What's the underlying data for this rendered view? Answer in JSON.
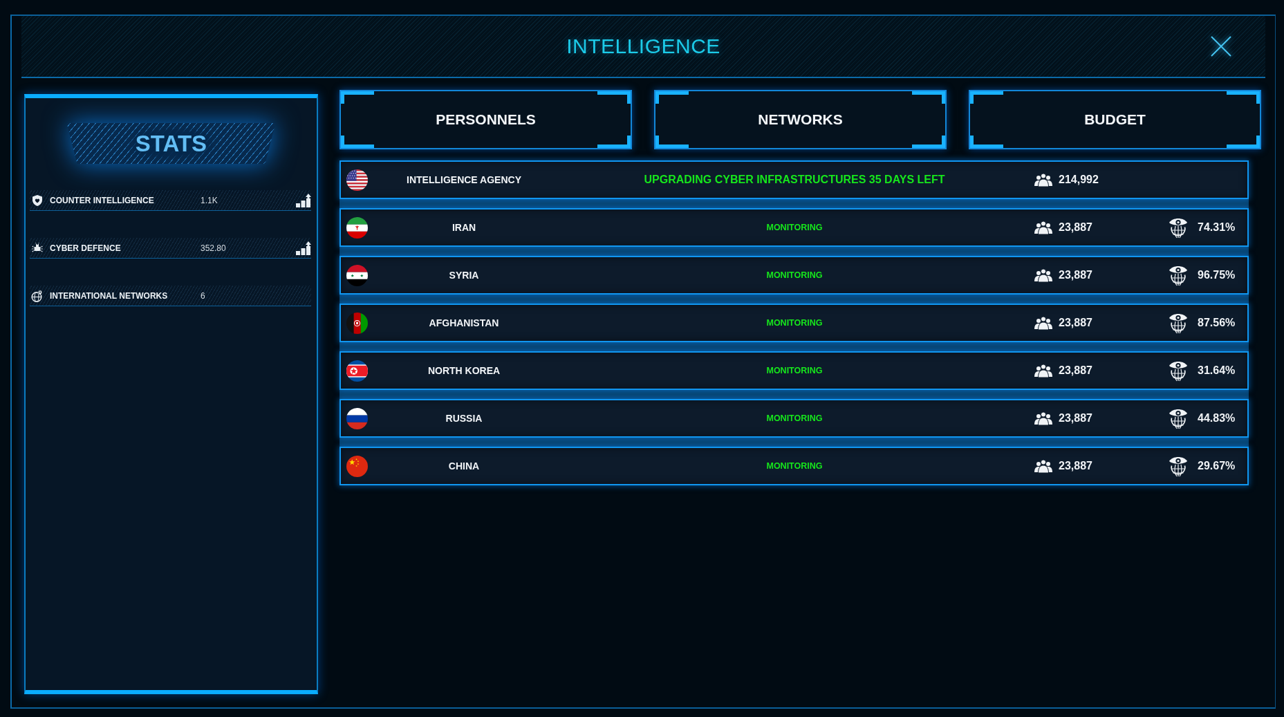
{
  "window": {
    "title": "INTELLIGENCE"
  },
  "stats": {
    "title": "STATS",
    "items": [
      {
        "kind": "counter",
        "label": "COUNTER INTELLIGENCE",
        "value": "1.1K",
        "upgrade": true
      },
      {
        "kind": "defence",
        "label": "CYBER DEFENCE",
        "value": "352.80",
        "upgrade": true
      },
      {
        "kind": "networks",
        "label": "INTERNATIONAL NETWORKS",
        "value": "6",
        "upgrade": false
      }
    ]
  },
  "menu_buttons": [
    "PERSONNELS",
    "NETWORKS",
    "BUDGET"
  ],
  "rows": [
    {
      "kind": "usa",
      "emphasized": true,
      "name": "INTELLIGENCE AGENCY",
      "status": "UPGRADING CYBER INFRASTRUCTURES 35 DAYS LEFT",
      "personnel": "214,992"
    },
    {
      "kind": "iran",
      "emphasized": false,
      "name": "IRAN",
      "status": "MONITORING",
      "personnel": "23,887",
      "percentage": "74.31%"
    },
    {
      "kind": "syria",
      "emphasized": false,
      "name": "SYRIA",
      "status": "MONITORING",
      "personnel": "23,887",
      "percentage": "96.75%"
    },
    {
      "kind": "afghanistan",
      "emphasized": false,
      "name": "AFGHANISTAN",
      "status": "MONITORING",
      "personnel": "23,887",
      "percentage": "87.56%"
    },
    {
      "kind": "northkorea",
      "emphasized": false,
      "name": "NORTH KOREA",
      "status": "MONITORING",
      "personnel": "23,887",
      "percentage": "31.64%"
    },
    {
      "kind": "russia",
      "emphasized": false,
      "name": "RUSSIA",
      "status": "MONITORING",
      "personnel": "23,887",
      "percentage": "44.83%"
    },
    {
      "kind": "china",
      "emphasized": false,
      "name": "CHINA",
      "status": "MONITORING",
      "personnel": "23,887",
      "percentage": "29.67%"
    }
  ]
}
